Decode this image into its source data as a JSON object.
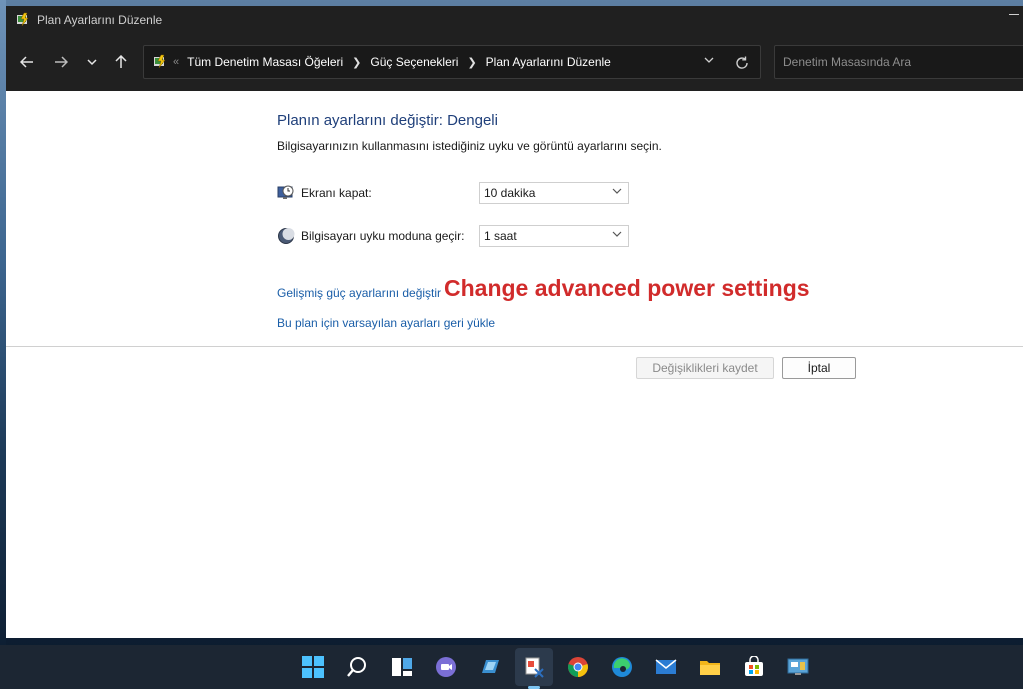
{
  "window": {
    "title": "Plan Ayarlarını Düzenle"
  },
  "navigation": {
    "back_icon": "back-arrow-icon",
    "forward_icon": "forward-arrow-icon",
    "recent_icon": "chevron-down-icon",
    "up_icon": "up-arrow-icon"
  },
  "address": {
    "overflow": "«",
    "crumbs": [
      "Tüm Denetim Masası Öğeleri",
      "Güç Seçenekleri",
      "Plan Ayarlarını Düzenle"
    ]
  },
  "search": {
    "placeholder": "Denetim Masasında Ara"
  },
  "content": {
    "title": "Planın ayarlarını değiştir: Dengeli",
    "subtitle": "Bilgisayarınızın kullanmasını istediğiniz uyku ve görüntü ayarlarını seçin.",
    "display_label": "Ekranı kapat:",
    "display_value": "10 dakika",
    "sleep_label": "Bilgisayarı uyku moduna geçir:",
    "sleep_value": "1 saat",
    "advanced_link": "Gelişmiş güç ayarlarını değiştir",
    "restore_link": "Bu plan için varsayılan ayarları geri yükle",
    "annotation": "Change advanced power settings",
    "annotation_color": "#d12b2b"
  },
  "buttons": {
    "save": "Değişiklikleri kaydet",
    "cancel": "İptal"
  },
  "taskbar": {
    "icons": [
      "windows-start-icon",
      "search-icon",
      "task-view-icon",
      "teams-chat-icon",
      "widgets-icon",
      "snipping-tool-icon",
      "chrome-icon",
      "edge-icon",
      "mail-icon",
      "file-explorer-icon",
      "store-icon",
      "control-panel-icon"
    ],
    "active": "snipping-tool-icon"
  }
}
